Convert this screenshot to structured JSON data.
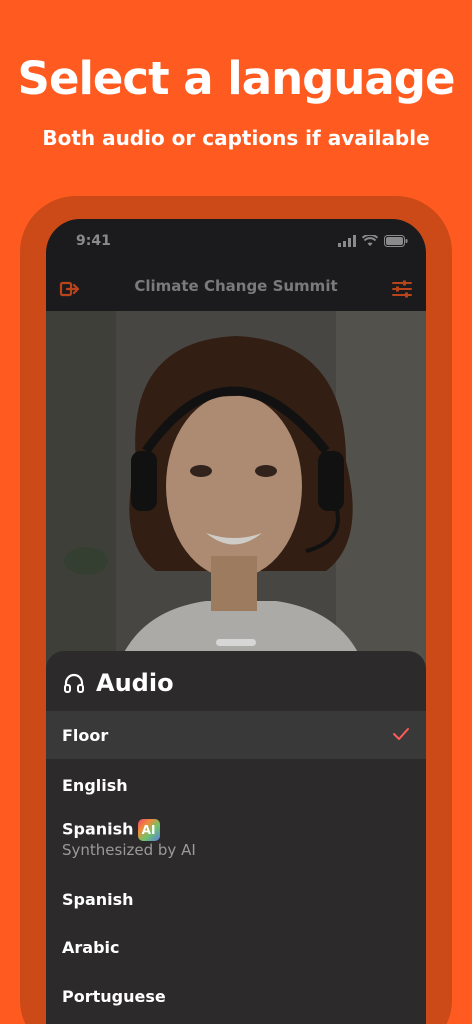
{
  "promo": {
    "headline": "Select a language",
    "subline": "Both audio or captions if available"
  },
  "status_bar": {
    "time": "9:41"
  },
  "header": {
    "title": "Climate Change Summit",
    "exit_icon": "exit-icon",
    "settings_icon": "sliders-icon"
  },
  "sheet": {
    "title": "Audio",
    "title_icon": "headphones-icon",
    "options": [
      {
        "label": "Floor",
        "selected": true
      },
      {
        "label": "English"
      },
      {
        "label": "Spanish",
        "badge": "AI",
        "sublabel": "Synthesized by AI"
      },
      {
        "label": "Spanish"
      },
      {
        "label": "Arabic"
      },
      {
        "label": "Portuguese"
      }
    ]
  },
  "colors": {
    "brand": "#FF5A1F",
    "frame": "#CC4A18",
    "accent_check": "#FF5B5B",
    "sheet_bg": "#2C2A2B"
  }
}
